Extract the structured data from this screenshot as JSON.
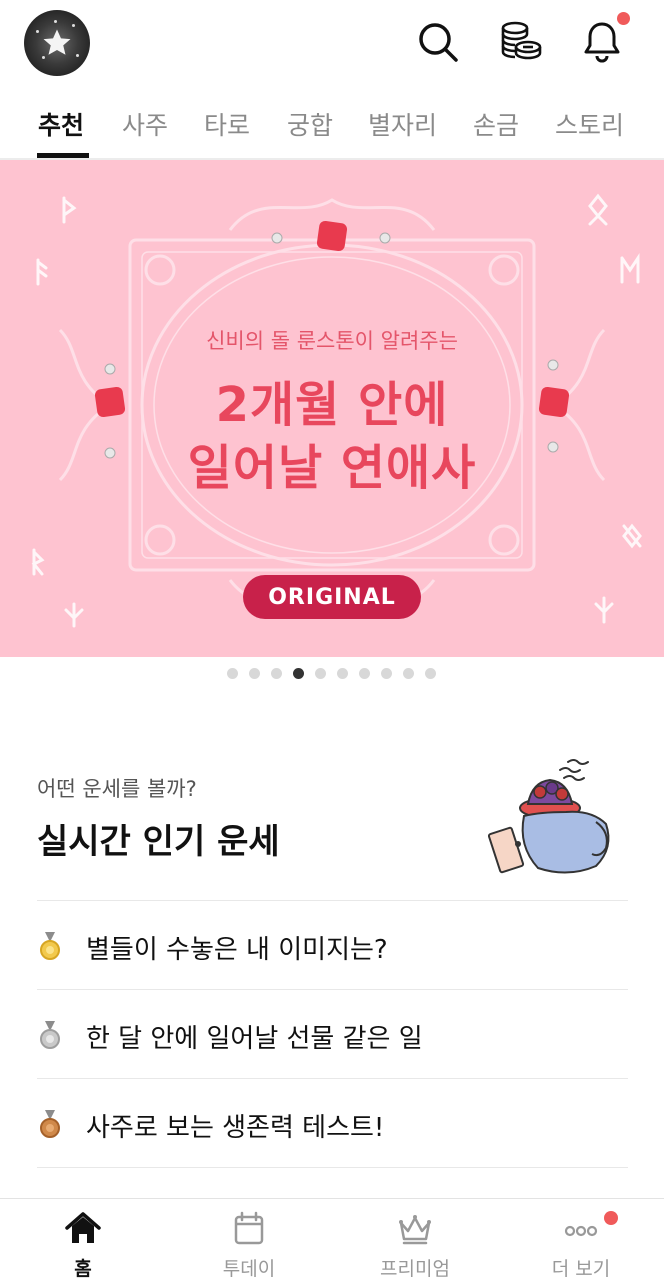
{
  "header": {
    "logo_icon": "star-logo-icon",
    "icons": [
      "search-icon",
      "coins-icon",
      "bell-icon"
    ],
    "notification_color": "#f05a5a"
  },
  "tabs": [
    {
      "label": "추천",
      "active": true
    },
    {
      "label": "사주",
      "active": false
    },
    {
      "label": "타로",
      "active": false
    },
    {
      "label": "궁합",
      "active": false
    },
    {
      "label": "별자리",
      "active": false
    },
    {
      "label": "손금",
      "active": false
    },
    {
      "label": "스토리",
      "active": false
    }
  ],
  "banner": {
    "subtitle": "신비의 돌 룬스톤이 알려주는",
    "title_line1": "2개월 안에",
    "title_line2": "일어날 연애사",
    "badge": "ORIGINAL",
    "background_color": "#fec3d0",
    "accent_color": "#c8214a",
    "page_count": 10,
    "current_page": 4
  },
  "popular": {
    "subtitle": "어떤 운세를 볼까?",
    "title": "실시간 인기 운세",
    "items": [
      {
        "medal": "gold-medal-icon",
        "text": "별들이 수놓은 내 이미지는?"
      },
      {
        "medal": "silver-medal-icon",
        "text": "한 달 안에 일어날 선물 같은 일"
      },
      {
        "medal": "bronze-medal-icon",
        "text": "사주로 보는 생존력 테스트!"
      }
    ]
  },
  "bottom_nav": [
    {
      "label": "홈",
      "icon": "home-icon",
      "active": true
    },
    {
      "label": "투데이",
      "icon": "calendar-icon",
      "active": false
    },
    {
      "label": "프리미엄",
      "icon": "crown-icon",
      "active": false
    },
    {
      "label": "더 보기",
      "icon": "more-icon",
      "active": false
    }
  ]
}
